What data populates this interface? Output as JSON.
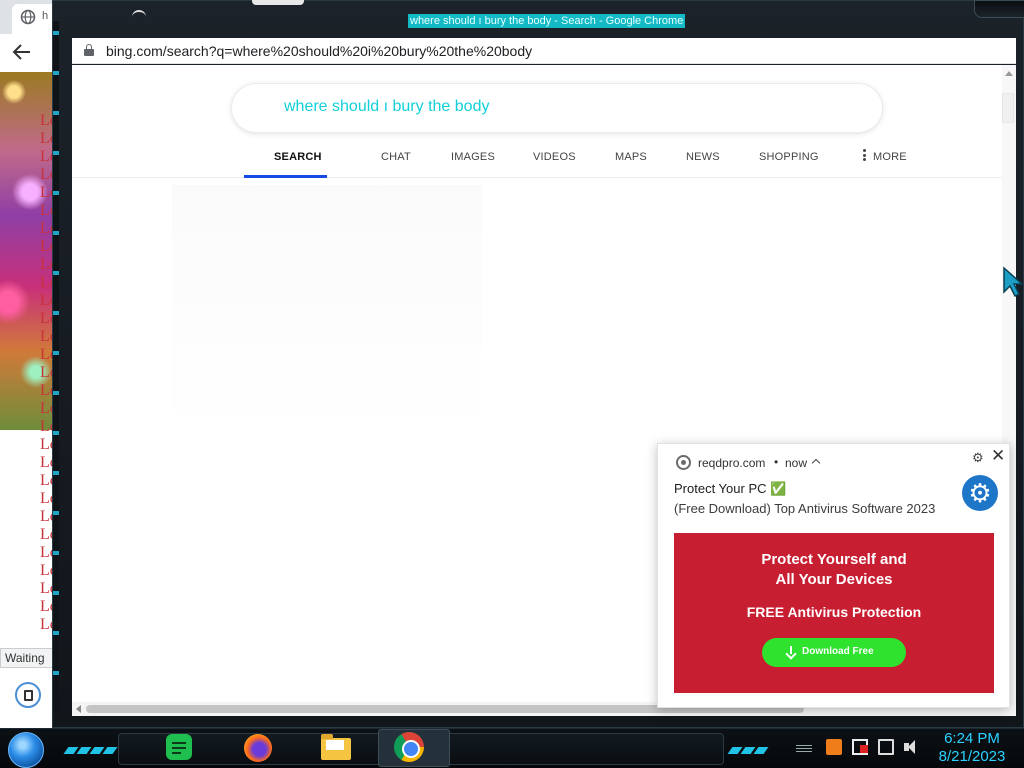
{
  "window": {
    "title": "where should ı bury the body - Search - Google Chrome"
  },
  "background_window": {
    "tab_label": "h",
    "lo_lines": [
      "Lo",
      "Lo",
      "Lo",
      "Lo",
      "Lo",
      "Lo",
      "Lo",
      "Lo",
      "Lo",
      "Lo",
      "Lo",
      "Lo",
      "Lo",
      "Lo",
      "Lo",
      "Lo",
      "Lo",
      "Lo",
      "Lo",
      "Lo",
      "Lo",
      "Lo",
      "Lo",
      "Lo",
      "Lo",
      "Lo",
      "Lo",
      "Lo",
      "Lo"
    ],
    "status_text": "Waiting"
  },
  "address_bar": {
    "url": "bing.com/search?q=where%20should%20i%20bury%20the%20body"
  },
  "search": {
    "query": "where should ı bury the body",
    "tabs": [
      {
        "label": "SEARCH",
        "active": true
      },
      {
        "label": "CHAT"
      },
      {
        "label": "IMAGES"
      },
      {
        "label": "VIDEOS"
      },
      {
        "label": "MAPS"
      },
      {
        "label": "NEWS"
      },
      {
        "label": "SHOPPING"
      },
      {
        "label": "MORE"
      }
    ]
  },
  "notification": {
    "source": "reqdpro.com",
    "separator": "•",
    "time": "now",
    "title": "Protect Your PC ✅",
    "body": "(Free Download) Top Antivirus Software 2023",
    "banner": {
      "headline_1": "Protect Yourself and",
      "headline_2": "All Your Devices",
      "subline": "FREE Antivirus Protection",
      "button_label": "Download Free",
      "bg_color": "#c81e32",
      "button_color": "#2ee22e"
    }
  },
  "taskbar": {
    "apps": [
      "notes-app",
      "firefox",
      "file-explorer",
      "google-chrome"
    ],
    "clock": {
      "time": "6:24 PM",
      "date": "8/21/2023"
    }
  },
  "colors": {
    "query_text": "#12d0d8",
    "active_tab_underline": "#174ae4",
    "clock_text": "#2bd2ff",
    "title_highlight": "#13b9c5"
  }
}
